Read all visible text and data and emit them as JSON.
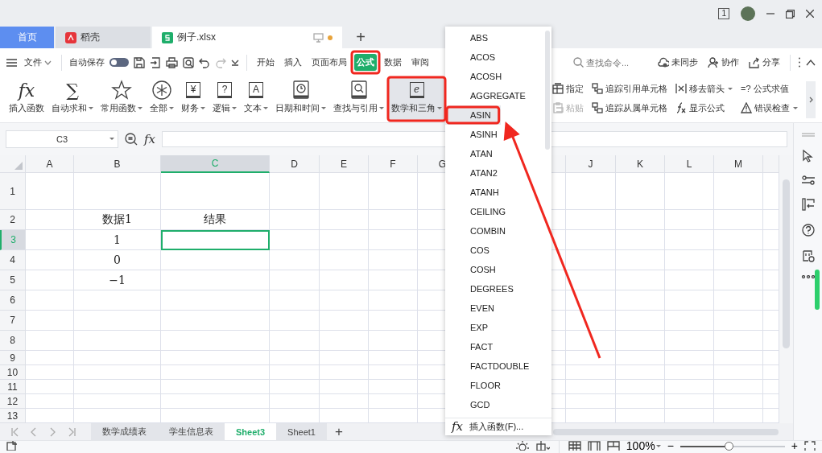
{
  "window": {
    "badge": "1"
  },
  "tabs": [
    {
      "label": "首页",
      "kind": "home",
      "selected": false
    },
    {
      "label": "稻壳",
      "kind": "docer",
      "selected": false
    },
    {
      "label": "例子.xlsx",
      "kind": "sheet",
      "selected": true,
      "unsaved": true
    }
  ],
  "new_tab": "+",
  "menu": {
    "file": "文件",
    "autosave": {
      "label": "自动保存",
      "on": false
    },
    "tabs": [
      {
        "label": "开始",
        "selected": false
      },
      {
        "label": "插入",
        "selected": false
      },
      {
        "label": "页面布局",
        "selected": false
      },
      {
        "label": "公式",
        "selected": true
      },
      {
        "label": "数据",
        "selected": false
      },
      {
        "label": "审阅",
        "selected": false
      }
    ],
    "search": {
      "placeholder": "查找命令..."
    },
    "actions": [
      {
        "label": "未同步",
        "kind": "cloud"
      },
      {
        "label": "协作",
        "kind": "people"
      },
      {
        "label": "分享",
        "kind": "share"
      }
    ]
  },
  "ribbon": {
    "groups": [
      {
        "label": "插入函数",
        "kind": "glyph",
        "glyph": "fx",
        "dropdown": false,
        "selected": false
      },
      {
        "label": "自动求和",
        "kind": "glyph",
        "glyph": "∑",
        "dropdown": true,
        "selected": false
      },
      {
        "label": "常用函数",
        "kind": "star",
        "dropdown": true,
        "selected": false
      },
      {
        "label": "全部",
        "kind": "asterisk",
        "dropdown": true,
        "selected": false
      },
      {
        "label": "财务",
        "kind": "book",
        "glyph": "¥",
        "dropdown": true,
        "selected": false
      },
      {
        "label": "逻辑",
        "kind": "book",
        "glyph": "?",
        "dropdown": true,
        "selected": false
      },
      {
        "label": "文本",
        "kind": "book",
        "glyph": "A",
        "dropdown": true,
        "selected": false
      },
      {
        "label": "日期和时间",
        "kind": "clock",
        "dropdown": true,
        "selected": false
      },
      {
        "label": "查找与引用",
        "kind": "lookup",
        "dropdown": true,
        "selected": false
      },
      {
        "label": "数学和三角",
        "kind": "book",
        "glyph": "e",
        "dropdown": true,
        "selected": true
      }
    ],
    "names": [
      {
        "label": "指定",
        "disabled": false
      },
      {
        "label": "粘贴",
        "disabled": true
      }
    ],
    "audit": [
      {
        "label": "追踪引用单元格",
        "kind": "trace",
        "dropdown": false
      },
      {
        "label": "追踪从属单元格",
        "kind": "trace",
        "dropdown": false
      },
      {
        "label": "移去箭头",
        "kind": "remove",
        "dropdown": true
      },
      {
        "label": "显示公式",
        "kind": "showfx",
        "dropdown": false
      },
      {
        "label": "公式求值",
        "kind": "eval",
        "glyph": "=?",
        "dropdown": false
      },
      {
        "label": "错误检查",
        "kind": "warn",
        "dropdown": true
      }
    ]
  },
  "formula_bar": {
    "name_box": "C3",
    "fx": "fx"
  },
  "grid": {
    "columns": [
      {
        "label": "A",
        "selected": false
      },
      {
        "label": "B",
        "selected": false
      },
      {
        "label": "C",
        "selected": true
      },
      {
        "label": "D",
        "selected": false
      },
      {
        "label": "E",
        "selected": false
      },
      {
        "label": "F",
        "selected": false
      },
      {
        "label": "G",
        "selected": false
      },
      {
        "label": "J",
        "selected": false
      },
      {
        "label": "K",
        "selected": false
      },
      {
        "label": "L",
        "selected": false
      },
      {
        "label": "M",
        "selected": false
      }
    ],
    "rows": [
      {
        "label": "1",
        "selected": false,
        "cells": []
      },
      {
        "label": "2",
        "selected": false,
        "cells": [
          null,
          {
            "text": "数据1",
            "selected": false
          },
          {
            "text": "结果",
            "selected": false
          }
        ]
      },
      {
        "label": "3",
        "selected": true,
        "cells": [
          null,
          {
            "text": "1",
            "selected": false
          },
          {
            "selected": true
          }
        ]
      },
      {
        "label": "4",
        "selected": false,
        "cells": [
          null,
          {
            "text": "0",
            "selected": false
          }
        ]
      },
      {
        "label": "5",
        "selected": false,
        "cells": [
          null,
          {
            "text": "−1",
            "selected": false
          }
        ]
      },
      {
        "label": "6",
        "selected": false,
        "cells": []
      },
      {
        "label": "7",
        "selected": false,
        "cells": []
      },
      {
        "label": "8",
        "selected": false,
        "cells": []
      },
      {
        "label": "9",
        "selected": false,
        "cells": []
      },
      {
        "label": "10",
        "selected": false,
        "cells": []
      },
      {
        "label": "11",
        "selected": false,
        "cells": []
      },
      {
        "label": "12",
        "selected": false,
        "cells": []
      },
      {
        "label": "13",
        "selected": false,
        "cells": []
      }
    ]
  },
  "sheets": [
    {
      "label": "数学成绩表",
      "selected": false
    },
    {
      "label": "学生信息表",
      "selected": false
    },
    {
      "label": "Sheet3",
      "selected": true
    },
    {
      "label": "Sheet1",
      "selected": false
    }
  ],
  "add_sheet": "+",
  "status_bar": {
    "zoom": "100%",
    "minus": "−",
    "plus": "+",
    "zoom_slider": {
      "level": 0.47
    }
  },
  "function_menu": {
    "items": [
      {
        "label": "ABS",
        "selected": false
      },
      {
        "label": "ACOS",
        "selected": false
      },
      {
        "label": "ACOSH",
        "selected": false
      },
      {
        "label": "AGGREGATE",
        "selected": false
      },
      {
        "label": "ASIN",
        "selected": true
      },
      {
        "label": "ASINH",
        "selected": false
      },
      {
        "label": "ATAN",
        "selected": false
      },
      {
        "label": "ATAN2",
        "selected": false
      },
      {
        "label": "ATANH",
        "selected": false
      },
      {
        "label": "CEILING",
        "selected": false
      },
      {
        "label": "COMBIN",
        "selected": false
      },
      {
        "label": "COS",
        "selected": false
      },
      {
        "label": "COSH",
        "selected": false
      },
      {
        "label": "DEGREES",
        "selected": false
      },
      {
        "label": "EVEN",
        "selected": false
      },
      {
        "label": "EXP",
        "selected": false
      },
      {
        "label": "FACT",
        "selected": false
      },
      {
        "label": "FACTDOUBLE",
        "selected": false
      },
      {
        "label": "FLOOR",
        "selected": false
      },
      {
        "label": "GCD",
        "selected": false
      }
    ],
    "footer": {
      "glyph": "fx",
      "label": "插入函数(F)..."
    }
  }
}
